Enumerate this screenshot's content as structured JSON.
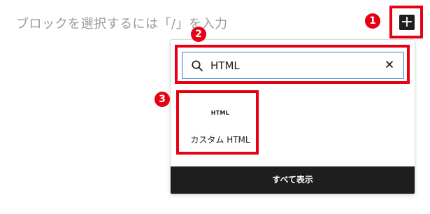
{
  "editor": {
    "placeholder": "ブロックを選択するには「/」を入力"
  },
  "inserter": {
    "toggle_symbol": "+",
    "toggle_icon": "plus-icon"
  },
  "search": {
    "value": "HTML",
    "search_icon": "search-icon",
    "clear_icon": "close-icon"
  },
  "results": [
    {
      "icon_text": "HTML",
      "label": "カスタム HTML"
    }
  ],
  "footer": {
    "browse_all_label": "すべて表示"
  },
  "annotations": {
    "color": "#e60012",
    "markers": [
      "1",
      "2",
      "3"
    ]
  }
}
